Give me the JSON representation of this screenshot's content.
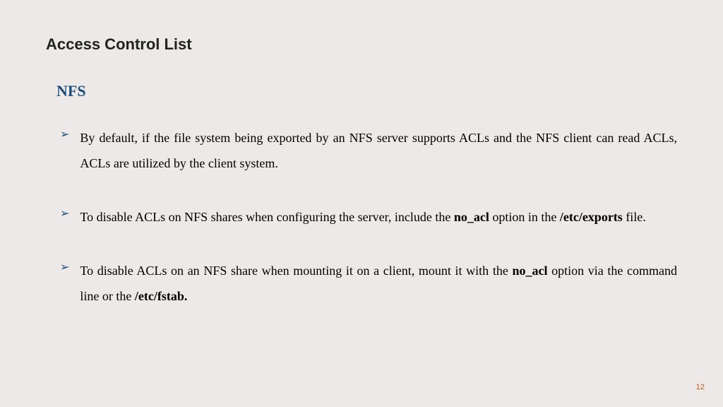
{
  "title": "Access Control List",
  "section": "NFS",
  "bullets": [
    {
      "pre1": "By default, if the file system being exported by an NFS server supports ACLs and the NFS client can read ACLs, ACLs are utilized by the client system."
    },
    {
      "pre1": "To disable ACLs on NFS shares when configuring the server, include the ",
      "bold1": "no_acl",
      "mid1": " option in the ",
      "bold2": "/etc/exports",
      "post1": " file."
    },
    {
      "pre1": "To disable ACLs on an NFS share when mounting it on a client, mount it with the ",
      "bold1": "no_acl",
      "mid1": " option via the command line or the ",
      "bold2": "/etc/fstab."
    }
  ],
  "pageNumber": "12"
}
